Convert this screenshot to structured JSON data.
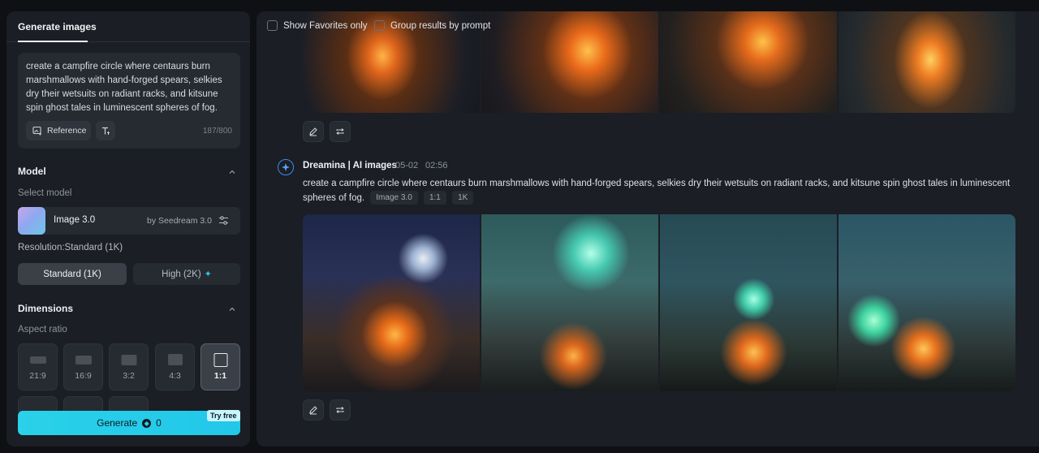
{
  "left_panel": {
    "tab_label": "Generate images",
    "prompt": {
      "text": "create a campfire circle where centaurs burn marshmallows with hand-forged spears, selkies dry their wetsuits on radiant racks, and kitsune spin ghost tales in luminescent spheres of fog.",
      "char_count": "187/800",
      "reference_label": "Reference"
    },
    "model_section": {
      "title": "Model",
      "select_label": "Select model",
      "model_name": "Image 3.0",
      "model_by": "by Seedream 3.0"
    },
    "resolution": {
      "label": "Resolution:Standard (1K)",
      "options": [
        "Standard (1K)",
        "High (2K)"
      ],
      "selected": "Standard (1K)"
    },
    "dimensions_section": {
      "title": "Dimensions",
      "aspect_label": "Aspect ratio",
      "ratios": [
        "21:9",
        "16:9",
        "3:2",
        "4:3",
        "1:1"
      ],
      "selected": "1:1"
    },
    "generate": {
      "label": "Generate",
      "cost": "0",
      "badge": "Try free"
    }
  },
  "right_panel": {
    "filters": {
      "favorites_label": "Show Favorites only",
      "group_label": "Group results by prompt"
    },
    "post": {
      "author": "Dreamina | AI images",
      "date": "05-02",
      "time": "02:56",
      "prompt": "create a campfire circle where centaurs burn marshmallows with hand-forged spears, selkies dry their wetsuits on radiant racks, and kitsune spin ghost tales in luminescent spheres of fog.",
      "tags": [
        "Image 3.0",
        "1:1",
        "1K"
      ]
    }
  },
  "colors": {
    "accent": "#22c7ea",
    "panel": "#1b1e24",
    "background": "#0e1014"
  }
}
